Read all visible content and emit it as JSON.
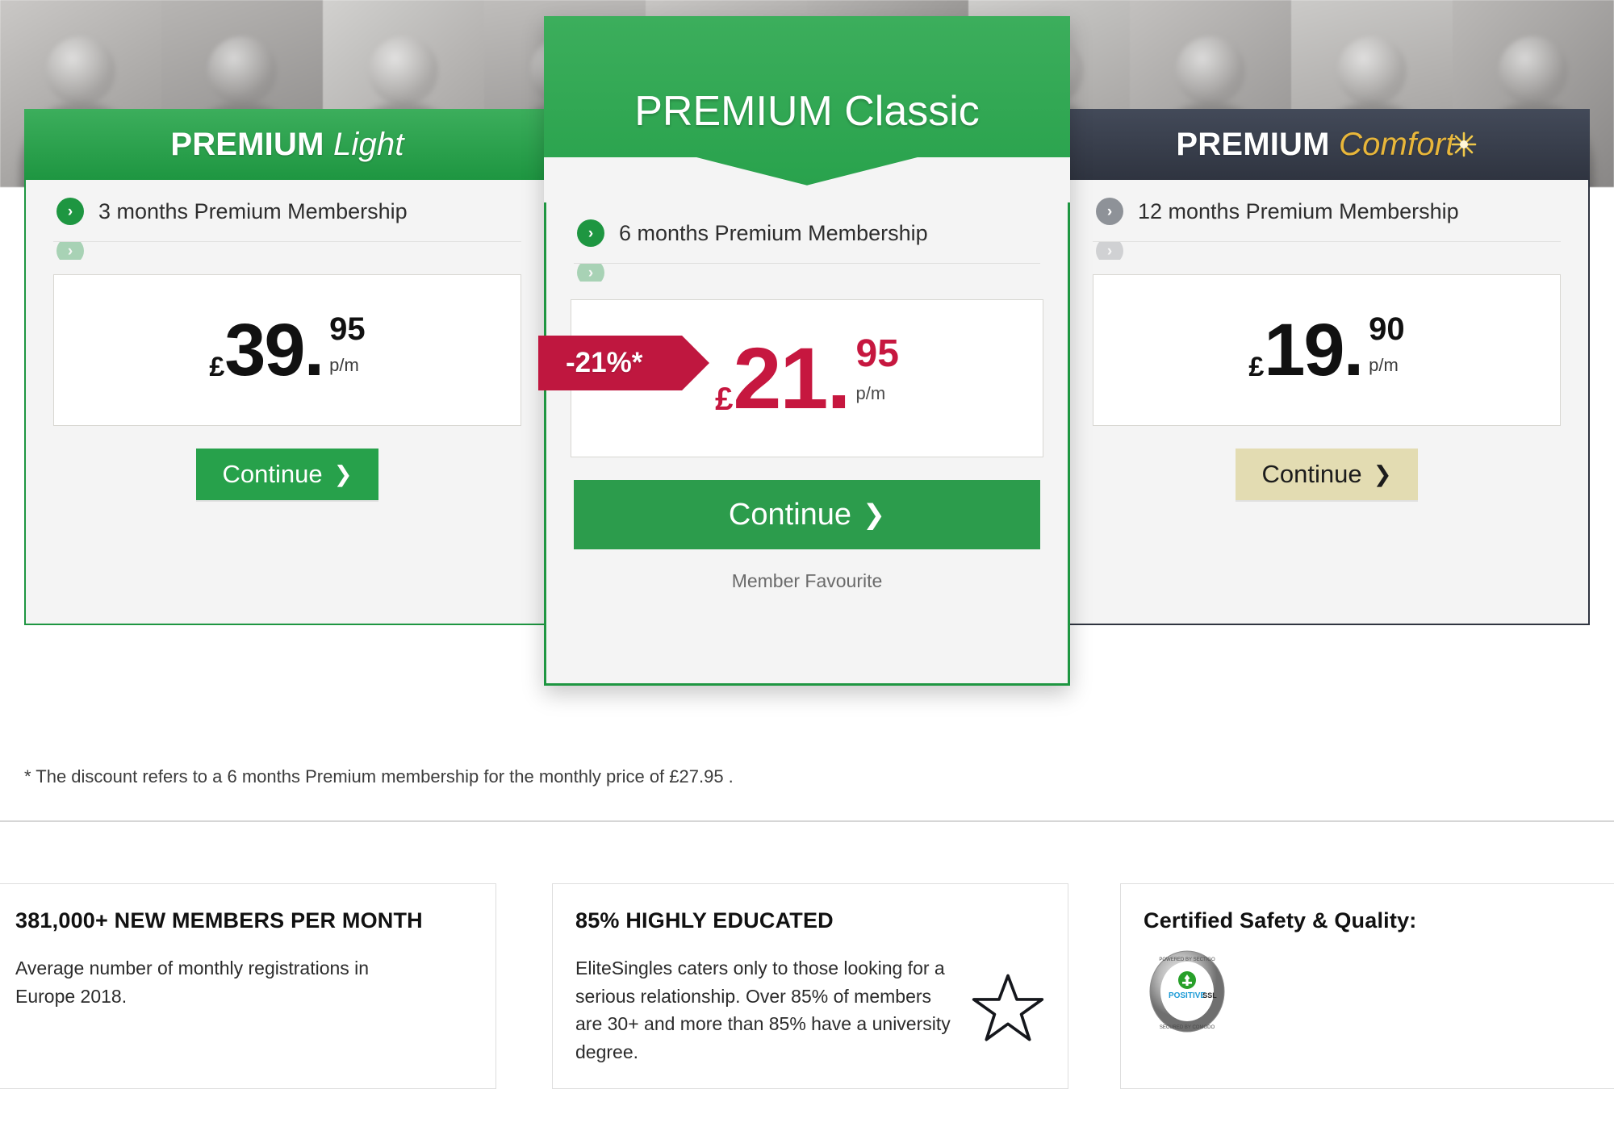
{
  "page": {
    "footnote": "* The discount refers to a 6 months Premium membership for the monthly price of £27.95 ."
  },
  "plans": [
    {
      "id": "premium-light",
      "title_bold": "PREMIUM",
      "title_light": "Light",
      "header_style": "green",
      "features": [
        {
          "label": "3 months Premium Membership",
          "bullet": "green"
        },
        {
          "label": "",
          "bullet": "green"
        }
      ],
      "currency": "£",
      "integer": "39",
      "decimal": "95",
      "period": "p/m",
      "price_color": "#111111",
      "cta": "Continue",
      "cta_style": "green"
    },
    {
      "id": "premium-classic",
      "title_bold": "PREMIUM",
      "title_light": "Classic",
      "header_style": "green-featured",
      "badge": "-21%*",
      "badge_color": "#bf173f",
      "features": [
        {
          "label": "6 months Premium Membership",
          "bullet": "green"
        },
        {
          "label": "",
          "bullet": "green"
        }
      ],
      "currency": "£",
      "integer": "21",
      "decimal": "95",
      "period": "p/m",
      "price_color": "#c6173f",
      "cta": "Continue",
      "cta_style": "green-large",
      "note": "Member Favourite"
    },
    {
      "id": "premium-comfort",
      "title_bold": "PREMIUM",
      "title_light": "Comfort",
      "header_style": "dark",
      "accent_color": "#e8b63a",
      "features": [
        {
          "label": "12 months Premium Membership",
          "bullet": "grey"
        },
        {
          "label": "",
          "bullet": "grey"
        }
      ],
      "currency": "£",
      "integer": "19",
      "decimal": "90",
      "period": "p/m",
      "price_color": "#111111",
      "cta": "Continue",
      "cta_style": "gold"
    }
  ],
  "info_cards": [
    {
      "id": "new-members",
      "heading": "381,000+ NEW MEMBERS PER MONTH",
      "text": "Average number of monthly registrations in Europe 2018.",
      "icon": "people-group-icon"
    },
    {
      "id": "highly-educated",
      "heading": "85% HIGHLY EDUCATED",
      "text": "EliteSingles caters only to those looking for a serious relationship. Over 85% of members are 30+ and more than 85% have a university degree.",
      "icon": "star-outline-icon"
    },
    {
      "id": "certified-safety",
      "heading": "Certified Safety & Quality:",
      "text": "",
      "icon": "positive-ssl-seal-icon",
      "seal_label": "POSITIVE SSL"
    }
  ]
}
